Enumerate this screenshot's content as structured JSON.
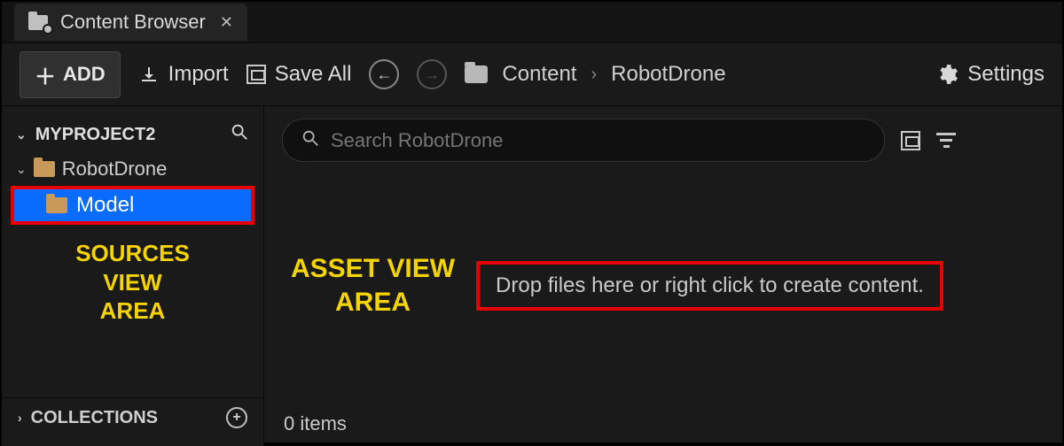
{
  "tab": {
    "title": "Content Browser"
  },
  "toolbar": {
    "add_label": "ADD",
    "import_label": "Import",
    "save_all_label": "Save All",
    "settings_label": "Settings",
    "breadcrumb": {
      "root": "Content",
      "current": "RobotDrone"
    }
  },
  "sidebar": {
    "project_label": "MYPROJECT2",
    "tree": {
      "root_folder": "RobotDrone",
      "selected_subfolder": "Model"
    },
    "annotation": "SOURCES\nVIEW\nAREA",
    "collections_label": "COLLECTIONS"
  },
  "assets": {
    "search_placeholder": "Search RobotDrone",
    "annotation": "ASSET VIEW\nAREA",
    "drop_hint": "Drop files here or right click to create content.",
    "status": "0 items"
  }
}
